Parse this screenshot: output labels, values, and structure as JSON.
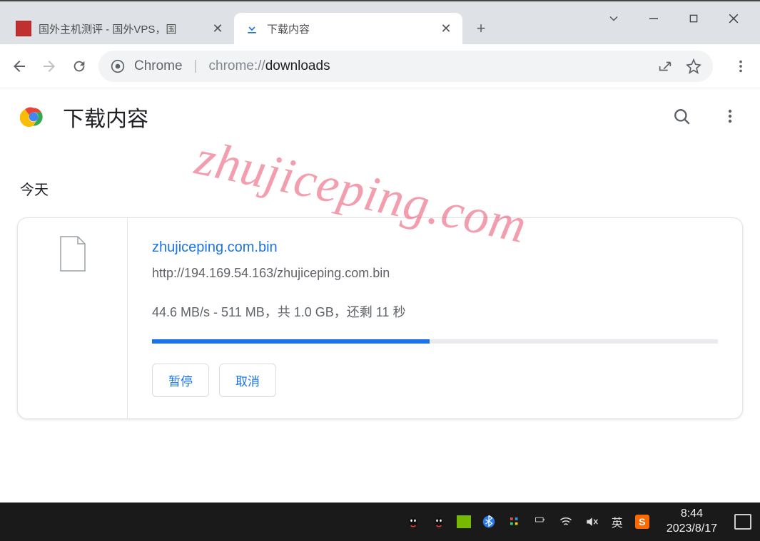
{
  "window": {
    "tabs": [
      {
        "title": "国外主机测评 - 国外VPS，国",
        "active": false
      },
      {
        "title": "下载内容",
        "active": true
      }
    ]
  },
  "omnibox": {
    "product": "Chrome",
    "url_prefix": "chrome://",
    "url_bold": "downloads"
  },
  "downloads": {
    "page_title": "下载内容",
    "section": "今天",
    "item": {
      "name": "zhujiceping.com.bin",
      "url": "http://194.169.54.163/zhujiceping.com.bin",
      "status": "44.6 MB/s - 511 MB，共 1.0 GB，还剩 11 秒",
      "progress_pct": 49,
      "pause_label": "暂停",
      "cancel_label": "取消"
    }
  },
  "taskbar": {
    "ime": "英",
    "time": "8:44",
    "date": "2023/8/17"
  },
  "watermark": "zhujiceping.com"
}
